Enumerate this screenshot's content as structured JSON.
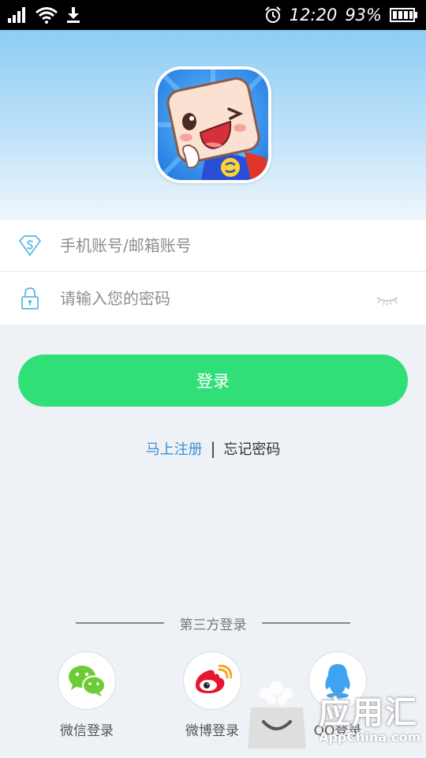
{
  "status_bar": {
    "time": "12:20",
    "battery_percent": "93%"
  },
  "form": {
    "account_placeholder": "手机账号/邮箱账号",
    "password_placeholder": "请输入您的密码"
  },
  "login_button": "登录",
  "links": {
    "register": "马上注册",
    "separator": "|",
    "forgot": "忘记密码"
  },
  "third_party": {
    "title": "第三方登录",
    "items": [
      {
        "label": "微信登录",
        "icon": "wechat-icon"
      },
      {
        "label": "微博登录",
        "icon": "weibo-icon"
      },
      {
        "label": "QQ登录",
        "icon": "qq-icon"
      }
    ]
  },
  "watermark": {
    "cn": "应用汇",
    "en": "AppChina.com"
  },
  "colors": {
    "accent_green": "#31df78",
    "link_blue": "#3a8fd6",
    "header_blue": "#8fcdf6"
  }
}
